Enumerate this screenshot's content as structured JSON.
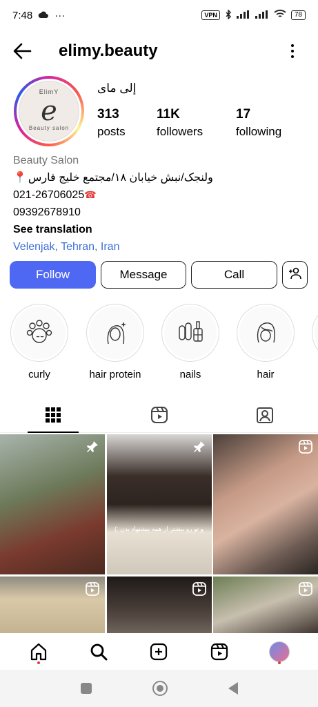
{
  "status_bar": {
    "time": "7:48",
    "dots": "···",
    "vpn": "VPN",
    "battery": "78"
  },
  "header": {
    "username": "elimy.beauty"
  },
  "profile": {
    "display_name": "إلى ماى",
    "avatar_text_top": "ElimY",
    "avatar_letter": "e",
    "avatar_text_bottom": "Beauty salon",
    "stats": {
      "posts": {
        "value": "313",
        "label": "posts"
      },
      "followers": {
        "value": "11K",
        "label": "followers"
      },
      "following": {
        "value": "17",
        "label": "following"
      }
    },
    "bio": {
      "category": "Beauty Salon",
      "address": "ولنجک/نبش خیابان ۱۸/مجتمع خلیج فارس",
      "phone1": "021-26706025",
      "phone2": "09392678910",
      "translate": "See translation",
      "location": "Velenjak, Tehran, Iran"
    }
  },
  "actions": {
    "follow": "Follow",
    "message": "Message",
    "call": "Call"
  },
  "highlights": [
    {
      "label": "curly",
      "icon": "curlers-face-icon"
    },
    {
      "label": "hair protein",
      "icon": "hair-sparkle-face-icon"
    },
    {
      "label": "nails",
      "icon": "nail-polish-icon"
    },
    {
      "label": "hair",
      "icon": "hair-face-icon"
    }
  ],
  "tabs": [
    "grid-icon",
    "reels-icon",
    "tagged-icon"
  ],
  "posts": [
    {
      "badge": "pin-icon"
    },
    {
      "badge": "pin-icon",
      "overlay": "و تو رو بیشتر از همه پیشنهاد بدن :)"
    },
    {
      "badge": "reel-icon"
    },
    {
      "badge": "reel-icon"
    },
    {
      "badge": "reel-icon"
    },
    {
      "badge": "reel-icon"
    }
  ],
  "bottom_nav": [
    "home-icon",
    "search-icon",
    "create-icon",
    "reels-icon",
    "profile-avatar"
  ],
  "colors": {
    "follow_button": "#4e68f3",
    "link": "#3f6fd8",
    "category": "#737373"
  }
}
